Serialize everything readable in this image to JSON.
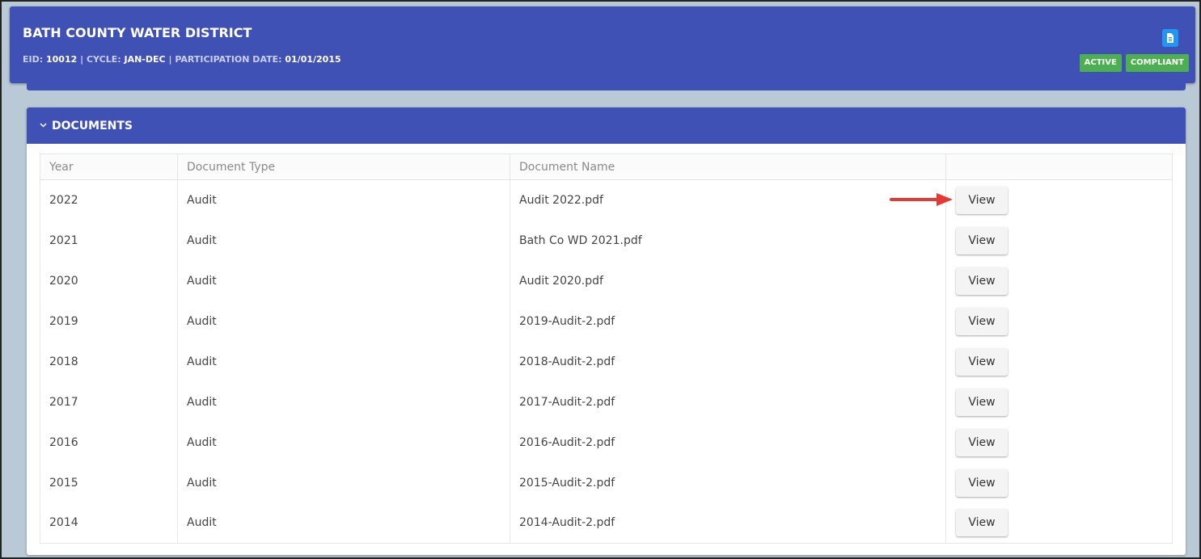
{
  "header": {
    "title": "BATH COUNTY WATER DISTRICT",
    "eid_label": "EID:",
    "eid_value": "10012",
    "cycle_label": "CYCLE:",
    "cycle_value": "JAN-DEC",
    "participation_label": "PARTICIPATION DATE:",
    "participation_value": "01/01/2015",
    "separator": "|",
    "badges": [
      "ACTIVE",
      "COMPLIANT"
    ],
    "document_icon": "document-icon"
  },
  "documents": {
    "title": "DOCUMENTS",
    "columns": [
      "Year",
      "Document Type",
      "Document Name",
      ""
    ],
    "view_label": "View",
    "rows": [
      {
        "year": "2022",
        "type": "Audit",
        "name": "Audit 2022.pdf"
      },
      {
        "year": "2021",
        "type": "Audit",
        "name": "Bath Co WD 2021.pdf"
      },
      {
        "year": "2020",
        "type": "Audit",
        "name": "Audit 2020.pdf"
      },
      {
        "year": "2019",
        "type": "Audit",
        "name": "2019-Audit-2.pdf"
      },
      {
        "year": "2018",
        "type": "Audit",
        "name": "2018-Audit-2.pdf"
      },
      {
        "year": "2017",
        "type": "Audit",
        "name": "2017-Audit-2.pdf"
      },
      {
        "year": "2016",
        "type": "Audit",
        "name": "2016-Audit-2.pdf"
      },
      {
        "year": "2015",
        "type": "Audit",
        "name": "2015-Audit-2.pdf"
      },
      {
        "year": "2014",
        "type": "Audit",
        "name": "2014-Audit-2.pdf"
      }
    ]
  },
  "colors": {
    "primary": "#3f51b5",
    "badge_green": "#4caf50",
    "icon_blue": "#2196f3",
    "arrow_red": "#e53935"
  }
}
